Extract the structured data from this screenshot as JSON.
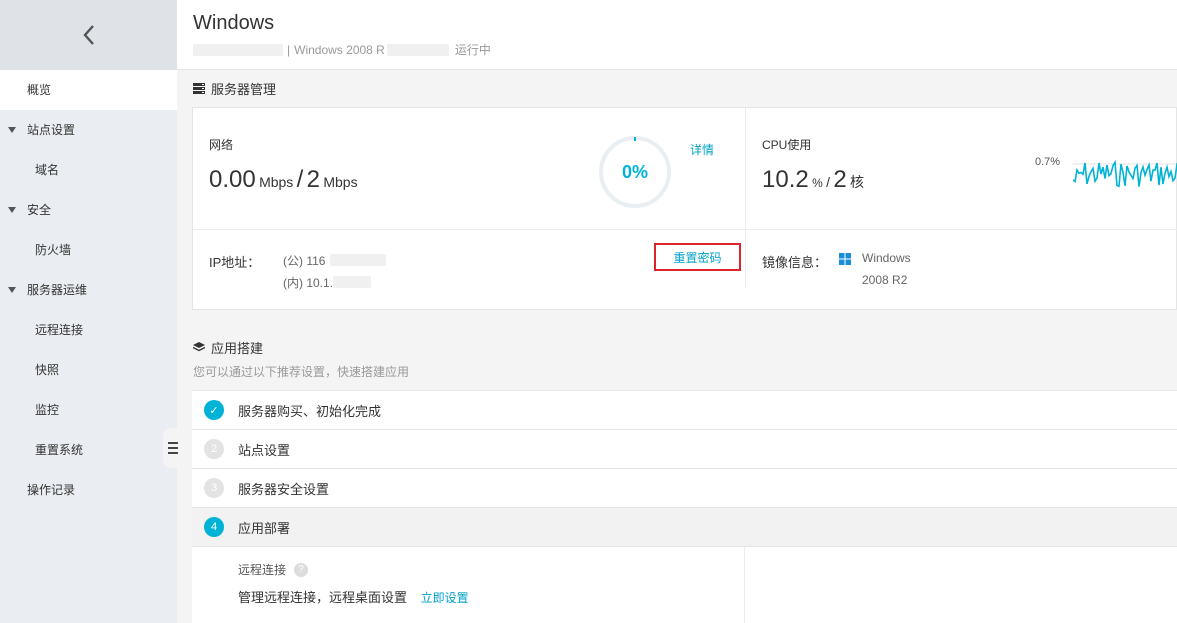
{
  "sidebar": {
    "items": [
      {
        "label": "概览"
      },
      {
        "label": "站点设置"
      },
      {
        "label": "域名"
      },
      {
        "label": "安全"
      },
      {
        "label": "防火墙"
      },
      {
        "label": "服务器运维"
      },
      {
        "label": "远程连接"
      },
      {
        "label": "快照"
      },
      {
        "label": "监控"
      },
      {
        "label": "重置系统"
      },
      {
        "label": "操作记录"
      }
    ]
  },
  "header": {
    "title": "Windows",
    "separator": "|",
    "os_text": "Windows 2008 R",
    "status": "运行中"
  },
  "server_section": {
    "title": "服务器管理",
    "network": {
      "label": "网络",
      "current": "0.00",
      "unit1": "Mbps",
      "slash": "/",
      "max": "2",
      "unit2": "Mbps",
      "gauge_text": "0%",
      "gauge_percent": 0,
      "details_link": "详情"
    },
    "cpu": {
      "label": "CPU使用",
      "value": "10.2",
      "unit": "%",
      "slash": "/",
      "cores": "2",
      "cores_unit": "核",
      "chart_label": "0.7%"
    },
    "ip": {
      "label": "IP地址：",
      "public": "(公) 116",
      "private": "(内) 10.1.",
      "reset_password": "重置密码"
    },
    "image": {
      "label": "镜像信息：",
      "line1": "Windows",
      "line2": "2008 R2"
    }
  },
  "app_section": {
    "title": "应用搭建",
    "subtitle": "您可以通过以下推荐设置，快速搭建应用",
    "steps": [
      {
        "num": "✓",
        "label": "服务器购买、初始化完成"
      },
      {
        "num": "2",
        "label": "站点设置"
      },
      {
        "num": "3",
        "label": "服务器安全设置"
      },
      {
        "num": "4",
        "label": "应用部署"
      }
    ],
    "detail": {
      "title": "远程连接",
      "help": "?",
      "desc": "管理远程连接，远程桌面设置",
      "action": "立即设置"
    }
  },
  "colors": {
    "accent": "#00a2ca",
    "highlight_box": "#d9252b",
    "windows_blue": "#1a8fd8"
  }
}
